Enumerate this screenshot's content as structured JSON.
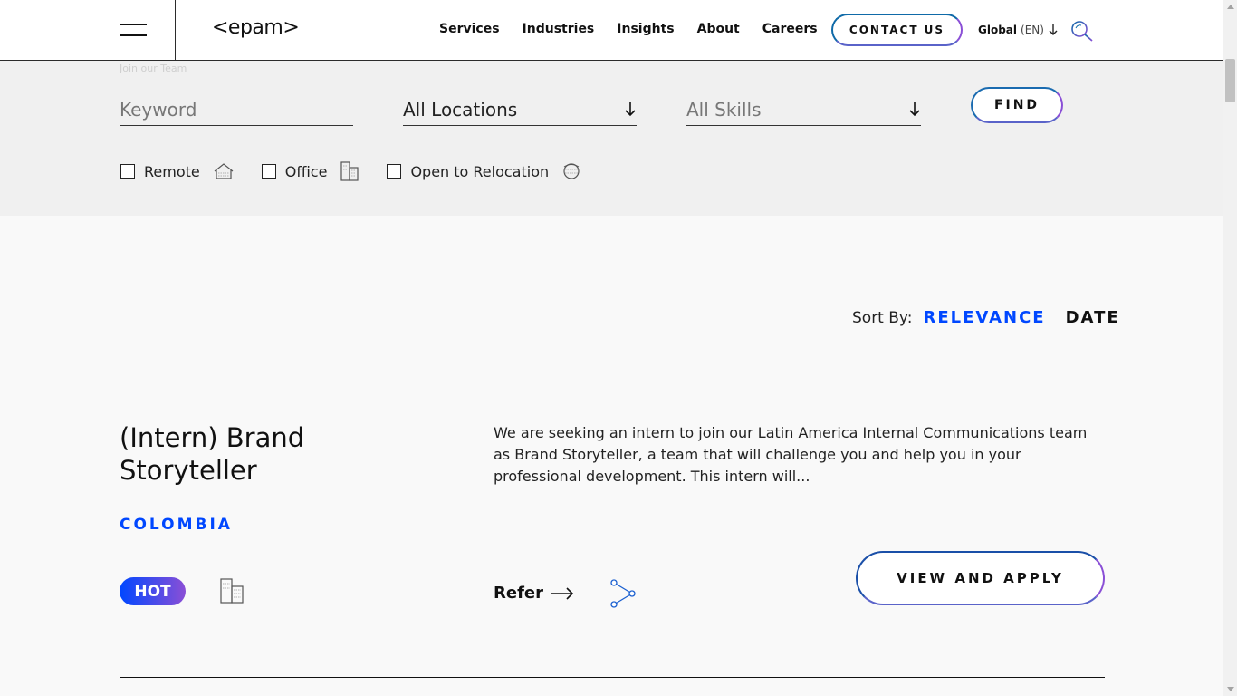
{
  "header": {
    "logo": "<epam>",
    "nav": [
      "Services",
      "Industries",
      "Insights",
      "About",
      "Careers"
    ],
    "contact_label": "CONTACT US",
    "region": "Global",
    "region_lang": "(EN)",
    "icons": [
      "menu-icon",
      "chevron-down-icon",
      "search-icon"
    ]
  },
  "filters": {
    "breadcrumb": "Join our Team",
    "keyword_placeholder": "Keyword",
    "location_value": "All Locations",
    "skills_placeholder": "All Skills",
    "find_label": "FIND",
    "checkboxes": [
      {
        "label": "Remote",
        "icon": "home-icon",
        "checked": false
      },
      {
        "label": "Office",
        "icon": "building-icon",
        "checked": false
      },
      {
        "label": "Open to Relocation",
        "icon": "relocation-icon",
        "checked": false
      }
    ]
  },
  "sort": {
    "label": "Sort By:",
    "relevance": "RELEVANCE",
    "date": "DATE",
    "active": "RELEVANCE"
  },
  "job": {
    "title": "(Intern) Brand Storyteller",
    "location": "COLOMBIA",
    "badge": "HOT",
    "description": "We are seeking an intern to join our Latin America Internal Communications team as Brand Storyteller, a team that will challenge you and help you in your professional development. This intern will...",
    "refer_label": "Refer",
    "apply_label": "VIEW AND APPLY"
  },
  "colors": {
    "accent_blue": "#0047ff",
    "accent_purple": "#8a4fd6",
    "header_border": "#2b2b2b"
  }
}
